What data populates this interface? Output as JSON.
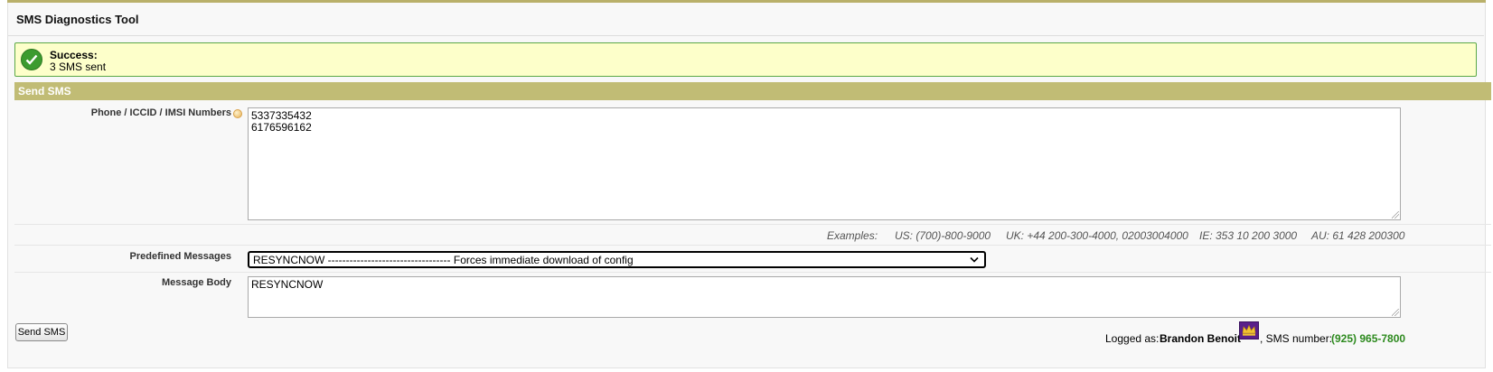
{
  "app": {
    "title": "SMS Diagnostics Tool"
  },
  "alert": {
    "title": "Success:",
    "message": "3 SMS sent",
    "color": "#5ba846"
  },
  "section": {
    "title": "Send SMS",
    "color": "#c1bc75"
  },
  "form": {
    "numbers_label": "Phone / ICCID / IMSI Numbers",
    "numbers_value": "5337335432\n6176596162",
    "examples": {
      "label": "Examples:",
      "us": "US: (700)-800-9000",
      "uk": "UK: +44 200-300-4000, 02003004000",
      "ie": "IE: 353 10 200 3000",
      "au": "AU: 61 428 200300"
    },
    "predefined_label": "Predefined Messages",
    "predefined_selected": "RESYNCNOW ---------------------------------- Forces immediate download of config",
    "body_label": "Message Body",
    "body_value": "RESYNCNOW",
    "send_button": "Send SMS"
  },
  "footer": {
    "logged_prefix": "Logged as: ",
    "user": "Brandon Benoit",
    "sms_prefix": ", SMS number: ",
    "sms_number": "(925) 965-7800",
    "sms_number_color": "#2d8a1e"
  },
  "icons": {
    "success": "check-circle-icon",
    "help": "help-icon",
    "avatar": "crown-avatar-icon",
    "select": "chevron-down-icon"
  }
}
